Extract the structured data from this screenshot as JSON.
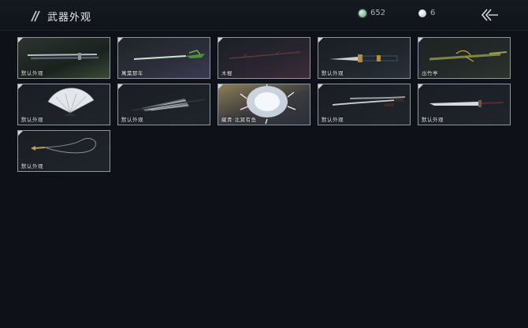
{
  "header": {
    "title": "武器外观",
    "currencies": [
      {
        "icon": "jade-coin-icon",
        "value": "652"
      },
      {
        "icon": "pearl-icon",
        "value": "6"
      }
    ],
    "back_icon": "back-arrow-icon"
  },
  "colors": {
    "background": "#0e1218",
    "card_border": "#8e959e",
    "jade": "#6fb08a"
  },
  "items": [
    {
      "label": "默认外观",
      "icon": "sword-icon"
    },
    {
      "label": "萬葉那年",
      "icon": "jade-sword-icon"
    },
    {
      "label": "木棍",
      "icon": "wooden-staff-icon"
    },
    {
      "label": "默认外观",
      "icon": "dagger-icon"
    },
    {
      "label": "出竹亭",
      "icon": "bamboo-spear-icon"
    },
    {
      "label": "默认外观",
      "icon": "fan-icon"
    },
    {
      "label": "默认外观",
      "icon": "umbrella-icon"
    },
    {
      "label": "藏青·北冥有鱼",
      "icon": "spirit-fish-icon"
    },
    {
      "label": "默认外观",
      "icon": "twin-blades-icon"
    },
    {
      "label": "默认外观",
      "icon": "long-blade-icon"
    },
    {
      "label": "默认外观",
      "icon": "rope-dart-icon"
    }
  ]
}
